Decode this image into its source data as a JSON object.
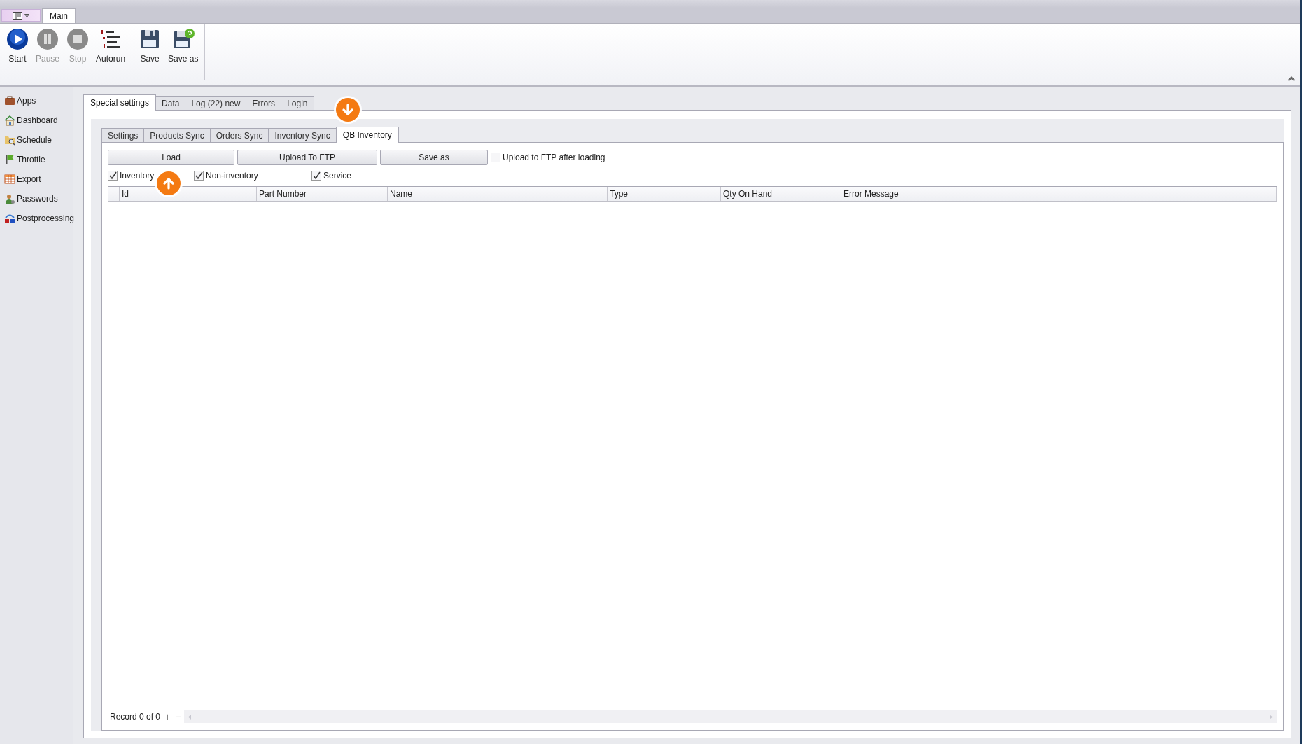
{
  "ribbon": {
    "tabs": [
      {
        "label": "Main",
        "selected": true
      }
    ],
    "groups": [
      {
        "buttons": [
          {
            "label": "Start",
            "kind": "play",
            "disabled": false
          },
          {
            "label": "Pause",
            "kind": "pause",
            "disabled": true
          },
          {
            "label": "Stop",
            "kind": "stop",
            "disabled": true
          },
          {
            "label": "Autorun",
            "kind": "list",
            "disabled": false
          }
        ]
      },
      {
        "buttons": [
          {
            "label": "Save",
            "kind": "save",
            "disabled": false
          },
          {
            "label": "Save as",
            "kind": "saveas",
            "disabled": false
          }
        ]
      }
    ]
  },
  "sidebar": {
    "items": [
      {
        "label": "Apps",
        "kind": "briefcase"
      },
      {
        "label": "Dashboard",
        "kind": "house"
      },
      {
        "label": "Schedule",
        "kind": "folder"
      },
      {
        "label": "Throttle",
        "kind": "flag"
      },
      {
        "label": "Export",
        "kind": "table"
      },
      {
        "label": "Passwords",
        "kind": "user"
      },
      {
        "label": "Postprocessing",
        "kind": "ab"
      }
    ]
  },
  "tabs": [
    {
      "label": "Special settings",
      "selected": true
    },
    {
      "label": "Data",
      "selected": false
    },
    {
      "label": "Log (22) new",
      "selected": false
    },
    {
      "label": "Errors",
      "selected": false
    },
    {
      "label": "Login",
      "selected": false
    }
  ],
  "sub_tabs": [
    {
      "label": "Settings",
      "selected": false
    },
    {
      "label": "Products Sync",
      "selected": false
    },
    {
      "label": "Orders Sync",
      "selected": false
    },
    {
      "label": "Inventory Sync",
      "selected": false
    },
    {
      "label": "QB Inventory",
      "selected": true
    }
  ],
  "toolbar": {
    "buttons": [
      "Load",
      "Upload To FTP",
      "Save as"
    ],
    "upload_after_loading": {
      "label": "Upload to FTP after loading",
      "checked": false
    }
  },
  "filters": [
    {
      "label": "Inventory",
      "checked": true
    },
    {
      "label": "Non-inventory",
      "checked": true
    },
    {
      "label": "Service",
      "checked": true
    }
  ],
  "table": {
    "columns": [
      "Id",
      "Part Number",
      "Name",
      "Type",
      "Qty On Hand",
      "Error Message"
    ]
  },
  "navigator": {
    "text": "Record 0 of 0",
    "add": "+",
    "remove": "−"
  },
  "annotations": [
    {
      "kind": "arrow-down"
    },
    {
      "kind": "arrow-up"
    }
  ]
}
